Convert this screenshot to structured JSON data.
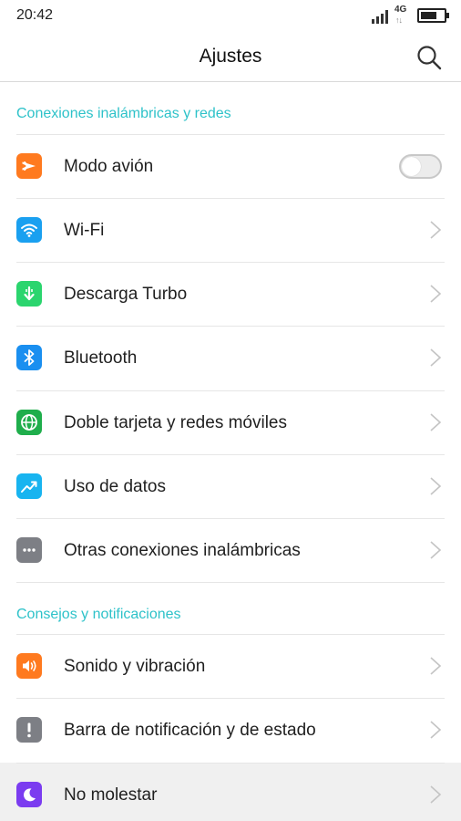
{
  "status_bar": {
    "time": "20:42",
    "network": "4G",
    "network_arrows": "↑↓"
  },
  "header": {
    "title": "Ajustes",
    "search_icon": "search-icon"
  },
  "sections": [
    {
      "title": "Conexiones inalámbricas y redes"
    },
    {
      "title": "Consejos y notificaciones"
    }
  ],
  "rows": [
    {
      "label": "Modo avión",
      "icon": "airplane-icon",
      "icon_color": "#ff7a1f",
      "control": "toggle",
      "toggle_on": false
    },
    {
      "label": "Wi-Fi",
      "icon": "wifi-icon",
      "icon_color": "#1aa0f0",
      "control": "chevron"
    },
    {
      "label": "Descarga Turbo",
      "icon": "download-arrow-icon",
      "icon_color": "#2bd56e",
      "control": "chevron"
    },
    {
      "label": "Bluetooth",
      "icon": "bluetooth-icon",
      "icon_color": "#1a8ff0",
      "control": "chevron"
    },
    {
      "label": "Doble tarjeta y redes móviles",
      "icon": "globe-icon",
      "icon_color": "#1fae4c",
      "control": "chevron"
    },
    {
      "label": "Uso de datos",
      "icon": "data-usage-icon",
      "icon_color": "#18b4f0",
      "control": "chevron"
    },
    {
      "label": "Otras conexiones inalámbricas",
      "icon": "more-dots-icon",
      "icon_color": "#7d7f85",
      "control": "chevron"
    },
    {
      "label": "Sonido y vibración",
      "icon": "speaker-icon",
      "icon_color": "#ff7a1f",
      "control": "chevron"
    },
    {
      "label": "Barra de notificación y de estado",
      "icon": "exclamation-icon",
      "icon_color": "#7d7f85",
      "control": "chevron"
    },
    {
      "label": "No molestar",
      "icon": "moon-icon",
      "icon_color": "#7b3cf0",
      "control": "chevron",
      "highlighted": true
    }
  ],
  "colors": {
    "accent": "#2ec2c9",
    "divider": "#e6e6e6",
    "text": "#1f1f1f"
  }
}
